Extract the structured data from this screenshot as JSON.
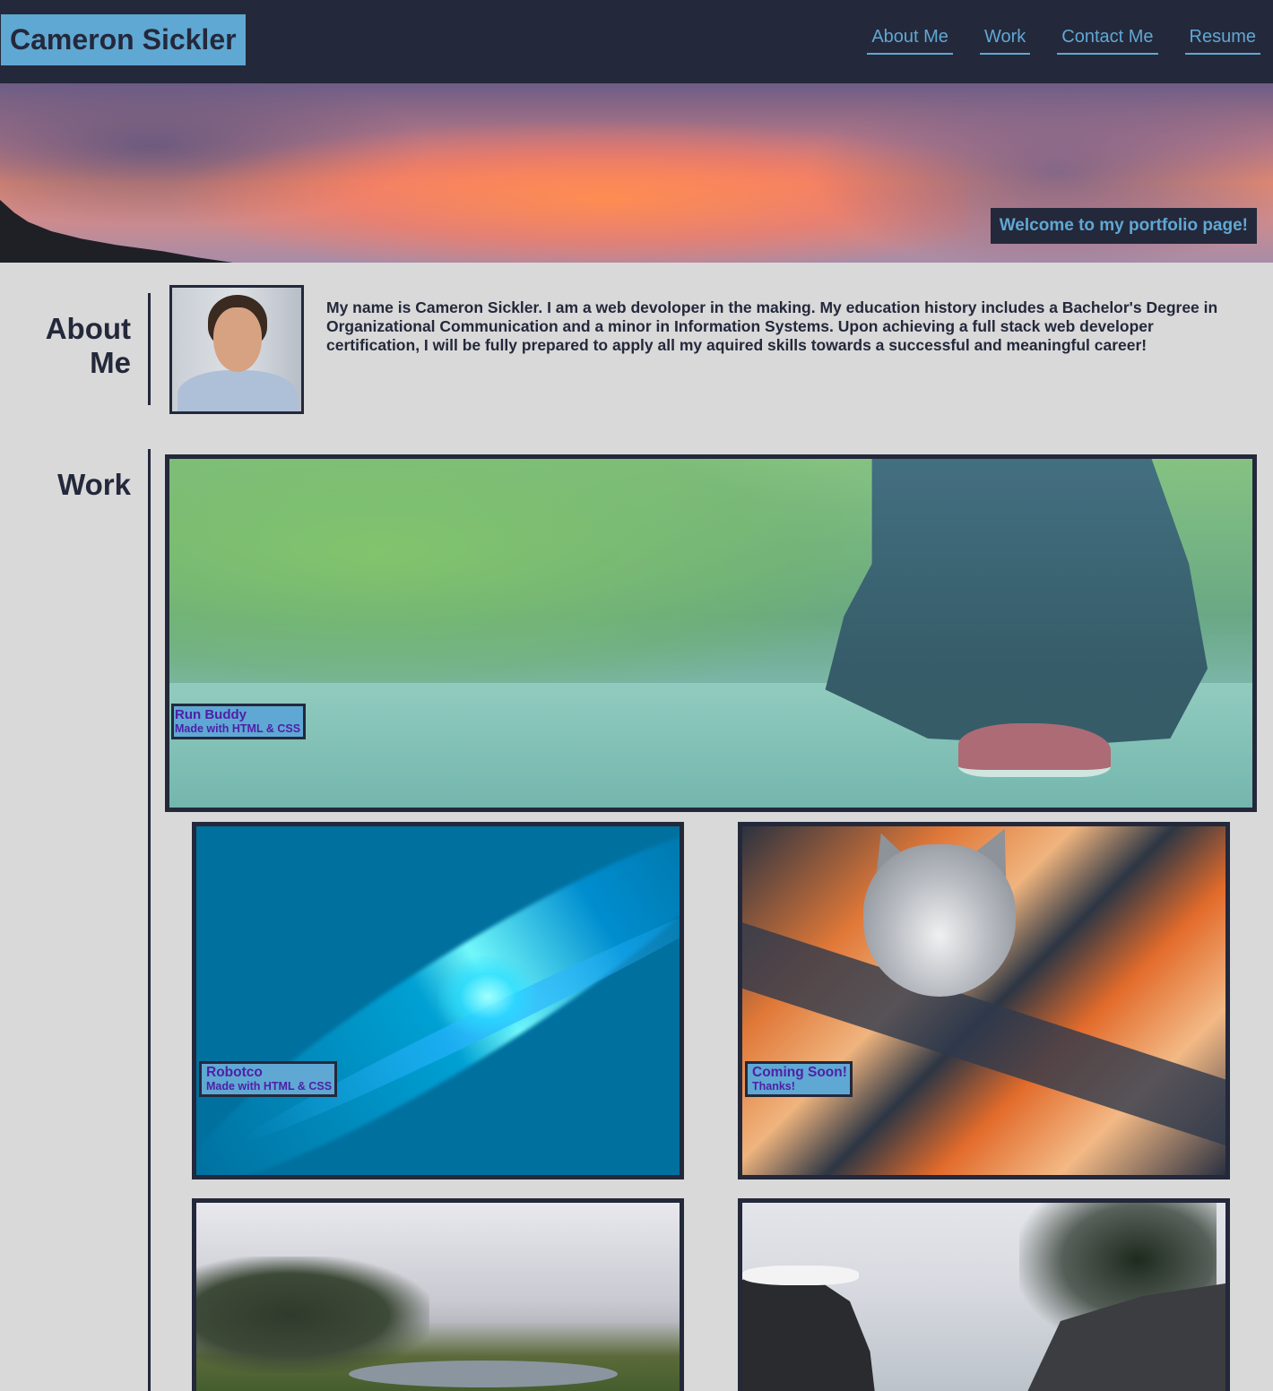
{
  "header": {
    "brand": "Cameron Sickler",
    "nav": [
      {
        "label": "About Me"
      },
      {
        "label": "Work"
      },
      {
        "label": "Contact Me"
      },
      {
        "label": "Resume"
      }
    ]
  },
  "hero": {
    "welcome": "Welcome to my portfolio page!"
  },
  "about": {
    "heading_line1": "About",
    "heading_line2": "Me",
    "bio": "My name is Cameron Sickler. I am a web devoloper in the making. My education history includes a Bachelor's Degree in Organizational Communication and a minor in Information Systems. Upon achieving a full stack web developer certification, I will be fully prepared to apply all my aquired skills towards a successful and meaningful career!"
  },
  "work": {
    "heading": "Work",
    "projects": [
      {
        "title": "Run Buddy",
        "subtitle": "Made with HTML & CSS"
      },
      {
        "title": "Robotco",
        "subtitle": "Made with HTML & CSS"
      },
      {
        "title": "Coming Soon!",
        "subtitle": "Thanks!"
      }
    ]
  },
  "colors": {
    "dark": "#24283b",
    "accent": "#5fa8d3",
    "label_text": "#4f1fa8",
    "page_bg": "#d9d9d9"
  }
}
